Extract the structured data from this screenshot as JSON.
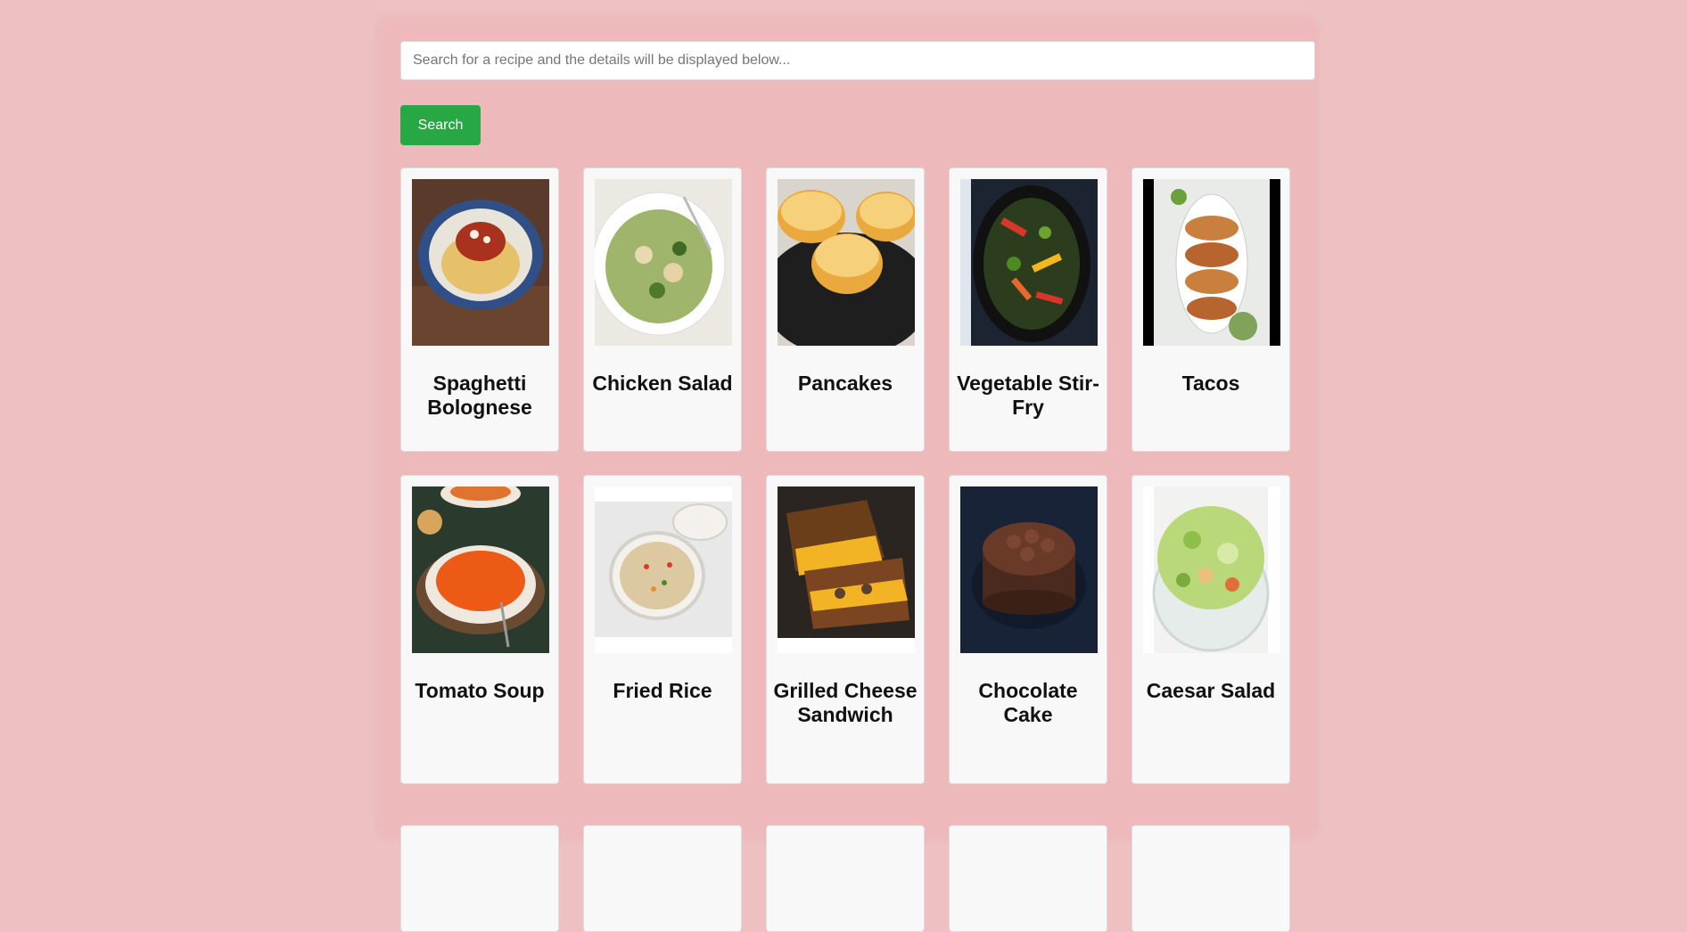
{
  "search": {
    "placeholder": "Search for a recipe and the details will be displayed below...",
    "value": "",
    "button_label": "Search"
  },
  "recipes": [
    {
      "title": "Spaghetti Bolognese",
      "image": "spaghetti-bolognese-photo"
    },
    {
      "title": "Chicken Salad",
      "image": "chicken-salad-photo"
    },
    {
      "title": "Pancakes",
      "image": "pancakes-photo"
    },
    {
      "title": "Vegetable Stir-Fry",
      "image": "vegetable-stir-fry-photo"
    },
    {
      "title": "Tacos",
      "image": "tacos-photo"
    },
    {
      "title": "Tomato Soup",
      "image": "tomato-soup-photo"
    },
    {
      "title": "Fried Rice",
      "image": "fried-rice-photo"
    },
    {
      "title": "Grilled Cheese Sandwich",
      "image": "grilled-cheese-sandwich-photo"
    },
    {
      "title": "Chocolate Cake",
      "image": "chocolate-cake-photo"
    },
    {
      "title": "Caesar Salad",
      "image": "caesar-salad-photo"
    }
  ],
  "colors": {
    "page_background": "#efc0c2",
    "button": "#28a745",
    "card": "#f8f8f8"
  }
}
